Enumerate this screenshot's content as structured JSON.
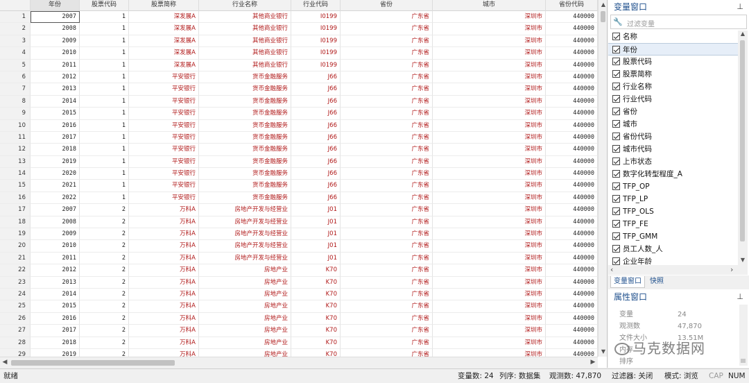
{
  "grid": {
    "columns": [
      "",
      "年份",
      "股票代码",
      "股票简称",
      "行业名称",
      "行业代码",
      "省份",
      "城市",
      "省份代码"
    ],
    "rows": [
      [
        "1",
        "2007",
        "1",
        "深发展A",
        "其他商业银行",
        "I0199",
        "广东省",
        "深圳市",
        "440000"
      ],
      [
        "2",
        "2008",
        "1",
        "深发展A",
        "其他商业银行",
        "I0199",
        "广东省",
        "深圳市",
        "440000"
      ],
      [
        "3",
        "2009",
        "1",
        "深发展A",
        "其他商业银行",
        "I0199",
        "广东省",
        "深圳市",
        "440000"
      ],
      [
        "4",
        "2010",
        "1",
        "深发展A",
        "其他商业银行",
        "I0199",
        "广东省",
        "深圳市",
        "440000"
      ],
      [
        "5",
        "2011",
        "1",
        "深发展A",
        "其他商业银行",
        "I0199",
        "广东省",
        "深圳市",
        "440000"
      ],
      [
        "6",
        "2012",
        "1",
        "平安银行",
        "货币金融服务",
        "J66",
        "广东省",
        "深圳市",
        "440000"
      ],
      [
        "7",
        "2013",
        "1",
        "平安银行",
        "货币金融服务",
        "J66",
        "广东省",
        "深圳市",
        "440000"
      ],
      [
        "8",
        "2014",
        "1",
        "平安银行",
        "货币金融服务",
        "J66",
        "广东省",
        "深圳市",
        "440000"
      ],
      [
        "9",
        "2015",
        "1",
        "平安银行",
        "货币金融服务",
        "J66",
        "广东省",
        "深圳市",
        "440000"
      ],
      [
        "10",
        "2016",
        "1",
        "平安银行",
        "货币金融服务",
        "J66",
        "广东省",
        "深圳市",
        "440000"
      ],
      [
        "11",
        "2017",
        "1",
        "平安银行",
        "货币金融服务",
        "J66",
        "广东省",
        "深圳市",
        "440000"
      ],
      [
        "12",
        "2018",
        "1",
        "平安银行",
        "货币金融服务",
        "J66",
        "广东省",
        "深圳市",
        "440000"
      ],
      [
        "13",
        "2019",
        "1",
        "平安银行",
        "货币金融服务",
        "J66",
        "广东省",
        "深圳市",
        "440000"
      ],
      [
        "14",
        "2020",
        "1",
        "平安银行",
        "货币金融服务",
        "J66",
        "广东省",
        "深圳市",
        "440000"
      ],
      [
        "15",
        "2021",
        "1",
        "平安银行",
        "货币金融服务",
        "J66",
        "广东省",
        "深圳市",
        "440000"
      ],
      [
        "16",
        "2022",
        "1",
        "平安银行",
        "货币金融服务",
        "J66",
        "广东省",
        "深圳市",
        "440000"
      ],
      [
        "17",
        "2007",
        "2",
        "万科A",
        "房地产开发与经营业",
        "J01",
        "广东省",
        "深圳市",
        "440000"
      ],
      [
        "18",
        "2008",
        "2",
        "万科A",
        "房地产开发与经营业",
        "J01",
        "广东省",
        "深圳市",
        "440000"
      ],
      [
        "19",
        "2009",
        "2",
        "万科A",
        "房地产开发与经营业",
        "J01",
        "广东省",
        "深圳市",
        "440000"
      ],
      [
        "20",
        "2010",
        "2",
        "万科A",
        "房地产开发与经营业",
        "J01",
        "广东省",
        "深圳市",
        "440000"
      ],
      [
        "21",
        "2011",
        "2",
        "万科A",
        "房地产开发与经营业",
        "J01",
        "广东省",
        "深圳市",
        "440000"
      ],
      [
        "22",
        "2012",
        "2",
        "万科A",
        "房地产业",
        "K70",
        "广东省",
        "深圳市",
        "440000"
      ],
      [
        "23",
        "2013",
        "2",
        "万科A",
        "房地产业",
        "K70",
        "广东省",
        "深圳市",
        "440000"
      ],
      [
        "24",
        "2014",
        "2",
        "万科A",
        "房地产业",
        "K70",
        "广东省",
        "深圳市",
        "440000"
      ],
      [
        "25",
        "2015",
        "2",
        "万科A",
        "房地产业",
        "K70",
        "广东省",
        "深圳市",
        "440000"
      ],
      [
        "26",
        "2016",
        "2",
        "万科A",
        "房地产业",
        "K70",
        "广东省",
        "深圳市",
        "440000"
      ],
      [
        "27",
        "2017",
        "2",
        "万科A",
        "房地产业",
        "K70",
        "广东省",
        "深圳市",
        "440000"
      ],
      [
        "28",
        "2018",
        "2",
        "万科A",
        "房地产业",
        "K70",
        "广东省",
        "深圳市",
        "440000"
      ],
      [
        "29",
        "2019",
        "2",
        "万科A",
        "房地产业",
        "K70",
        "广东省",
        "深圳市",
        "440000"
      ]
    ]
  },
  "variables_panel": {
    "title": "变量窗口",
    "filter_placeholder": "过滤变量",
    "header_label": "名称",
    "items": [
      "年份",
      "股票代码",
      "股票简称",
      "行业名称",
      "行业代码",
      "省份",
      "城市",
      "省份代码",
      "城市代码",
      "上市状态",
      "数字化转型程度_A",
      "TFP_OP",
      "TFP_LP",
      "TFP_OLS",
      "TFP_FE",
      "TFP_GMM",
      "员工人数_人",
      "企业年龄"
    ],
    "tabs": [
      "变量窗口",
      "快照"
    ]
  },
  "properties_panel": {
    "title": "属性窗口",
    "rows": [
      {
        "key": "变量",
        "value": "24"
      },
      {
        "key": "观测数",
        "value": "47,870"
      },
      {
        "key": "文件大小",
        "value": "13.51M"
      },
      {
        "key": "内存",
        "value": ""
      },
      {
        "key": "排序",
        "value": ""
      }
    ]
  },
  "watermark": "马克数据网",
  "statusbar": {
    "left": "就绪",
    "vars": "变量数: 24",
    "order": "列序: 数据集",
    "obs": "观测数: 47,870",
    "filter": "过滤器: 关闭",
    "mode": "模式: 浏览",
    "cap": "CAP",
    "num": "NUM"
  },
  "icons": {
    "pin": "pin-icon",
    "wrench": "wrench-icon",
    "up": "arrow-up-icon",
    "down": "arrow-down-icon",
    "left": "arrow-left-icon",
    "right": "arrow-right-icon"
  },
  "colors": {
    "string_text": "#b01818",
    "panel_title": "#1e4f8c"
  }
}
